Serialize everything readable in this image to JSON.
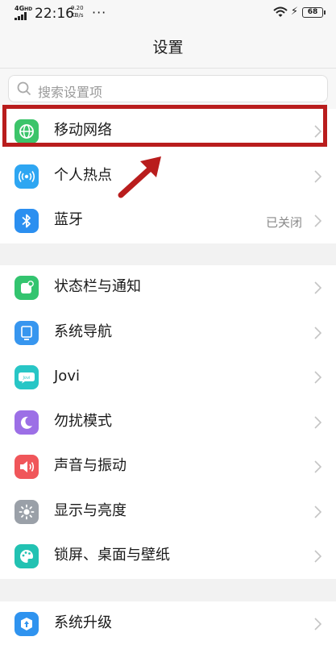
{
  "status_bar": {
    "network": "4G",
    "hd": "HD",
    "time": "22:16",
    "speed_value": "9.20",
    "speed_unit": "KB/s",
    "more": "···",
    "battery": "68"
  },
  "header": {
    "title": "设置"
  },
  "search": {
    "placeholder": "搜索设置项"
  },
  "colors": {
    "network_icon": "#3cc46a",
    "hotspot_icon": "#2ea6f2",
    "bluetooth_icon": "#2b8ff0",
    "status_bar_icon": "#33c46f",
    "navigation_icon": "#3796ef",
    "jovi_icon": "#28c6c6",
    "dnd_icon": "#9c6fe6",
    "sound_icon": "#f0565a",
    "display_icon": "#9aa0a8",
    "wallpaper_icon": "#22c2b2",
    "update_icon": "#2f93ef",
    "annotation": "#b91d1d"
  },
  "group1": [
    {
      "label": "移动网络",
      "icon": "globe-icon"
    },
    {
      "label": "个人热点",
      "icon": "hotspot-icon"
    },
    {
      "label": "蓝牙",
      "value": "已关闭",
      "icon": "bluetooth-icon"
    }
  ],
  "group2": [
    {
      "label": "状态栏与通知",
      "icon": "notification-icon"
    },
    {
      "label": "系统导航",
      "icon": "navigation-icon"
    },
    {
      "label": "Jovi",
      "icon": "jovi-icon"
    },
    {
      "label": "勿扰模式",
      "icon": "moon-icon"
    },
    {
      "label": "声音与振动",
      "icon": "speaker-icon"
    },
    {
      "label": "显示与亮度",
      "icon": "sun-icon"
    },
    {
      "label": "锁屏、桌面与壁纸",
      "icon": "palette-icon"
    }
  ],
  "group3": [
    {
      "label": "系统升级",
      "icon": "update-icon"
    }
  ]
}
